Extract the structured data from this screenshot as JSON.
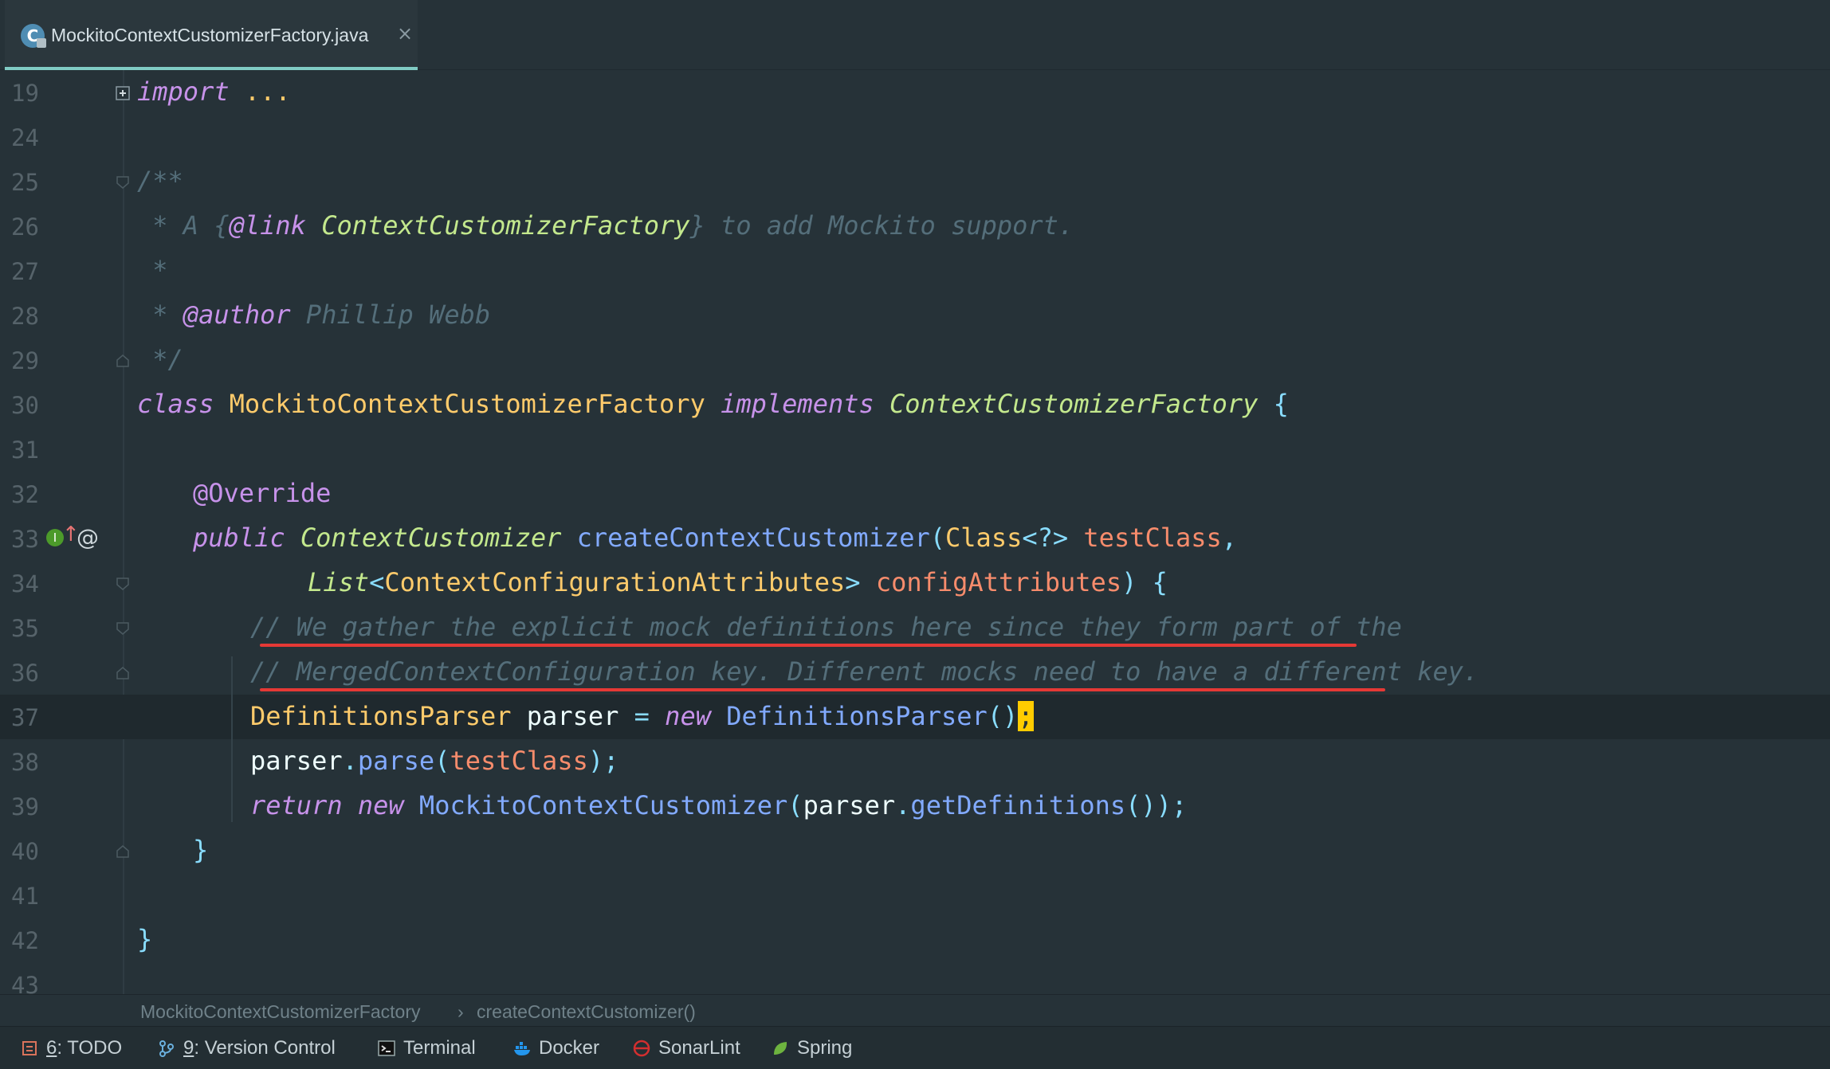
{
  "tab": {
    "label": "MockitoContextCustomizerFactory.java",
    "icon": "java-class-icon",
    "close": "×"
  },
  "lines": [
    {
      "n": "19",
      "tokens": [
        [
          "kw",
          "import"
        ],
        [
          "plain",
          " "
        ],
        [
          "cls",
          "..."
        ]
      ]
    },
    {
      "n": "24",
      "tokens": []
    },
    {
      "n": "25",
      "tokens": [
        [
          "cm",
          "/**"
        ]
      ]
    },
    {
      "n": "26",
      "tokens": [
        [
          "cm",
          " * A {"
        ],
        [
          "doctag",
          "@link"
        ],
        [
          "cm",
          " "
        ],
        [
          "docref",
          "ContextCustomizerFactory"
        ],
        [
          "cm",
          "} to add Mockito support."
        ]
      ]
    },
    {
      "n": "27",
      "tokens": [
        [
          "cm",
          " *"
        ]
      ]
    },
    {
      "n": "28",
      "tokens": [
        [
          "cm",
          " * "
        ],
        [
          "doctag",
          "@author"
        ],
        [
          "cm",
          " Phillip Webb"
        ]
      ]
    },
    {
      "n": "29",
      "tokens": [
        [
          "cm",
          " */"
        ]
      ]
    },
    {
      "n": "30",
      "tokens": [
        [
          "kw",
          "class"
        ],
        [
          "plain",
          " "
        ],
        [
          "cls",
          "MockitoContextCustomizerFactory"
        ],
        [
          "plain",
          " "
        ],
        [
          "kw",
          "implements"
        ],
        [
          "plain",
          " "
        ],
        [
          "iface",
          "ContextCustomizerFactory"
        ],
        [
          "plain",
          " "
        ],
        [
          "punc",
          "{"
        ]
      ]
    },
    {
      "n": "31",
      "tokens": []
    },
    {
      "n": "32",
      "tokens": [
        [
          "ann",
          "@Override"
        ]
      ]
    },
    {
      "n": "33",
      "tokens": [
        [
          "kw",
          "public"
        ],
        [
          "plain",
          " "
        ],
        [
          "iface",
          "ContextCustomizer"
        ],
        [
          "plain",
          " "
        ],
        [
          "fn",
          "createContextCustomizer"
        ],
        [
          "punc",
          "("
        ],
        [
          "cls",
          "Class"
        ],
        [
          "punc",
          "<?>"
        ],
        [
          "plain",
          " "
        ],
        [
          "param",
          "testClass"
        ],
        [
          "punc",
          ","
        ]
      ]
    },
    {
      "n": "34",
      "tokens": [
        [
          "iface",
          "List"
        ],
        [
          "punc",
          "<"
        ],
        [
          "cls",
          "ContextConfigurationAttributes"
        ],
        [
          "punc",
          ">"
        ],
        [
          "plain",
          " "
        ],
        [
          "param",
          "configAttributes"
        ],
        [
          "punc",
          ")"
        ],
        [
          "plain",
          " "
        ],
        [
          "punc",
          "{"
        ]
      ]
    },
    {
      "n": "35",
      "tokens": [
        [
          "cm",
          "// We gather the explicit mock definitions here since they form part of the"
        ]
      ]
    },
    {
      "n": "36",
      "tokens": [
        [
          "cm",
          "// MergedContextConfiguration key. Different mocks need to have a different key."
        ]
      ]
    },
    {
      "n": "37",
      "tokens": [
        [
          "cls",
          "DefinitionsParser"
        ],
        [
          "plain",
          " parser "
        ],
        [
          "punc",
          "="
        ],
        [
          "plain",
          " "
        ],
        [
          "kw",
          "new"
        ],
        [
          "plain",
          " "
        ],
        [
          "fn",
          "DefinitionsParser"
        ],
        [
          "punc",
          "()"
        ],
        [
          "caret",
          ";"
        ]
      ]
    },
    {
      "n": "38",
      "tokens": [
        [
          "plain",
          "parser"
        ],
        [
          "punc",
          "."
        ],
        [
          "fn",
          "parse"
        ],
        [
          "punc",
          "("
        ],
        [
          "param",
          "testClass"
        ],
        [
          "punc",
          ");"
        ]
      ]
    },
    {
      "n": "39",
      "tokens": [
        [
          "kw",
          "return"
        ],
        [
          "plain",
          " "
        ],
        [
          "kw",
          "new"
        ],
        [
          "plain",
          " "
        ],
        [
          "fn",
          "MockitoContextCustomizer"
        ],
        [
          "punc",
          "("
        ],
        [
          "plain",
          "parser"
        ],
        [
          "punc",
          "."
        ],
        [
          "fn",
          "getDefinitions"
        ],
        [
          "punc",
          "());"
        ]
      ]
    },
    {
      "n": "40",
      "tokens": [
        [
          "punc",
          "}"
        ]
      ]
    },
    {
      "n": "41",
      "tokens": []
    },
    {
      "n": "42",
      "tokens": [
        [
          "punc",
          "}"
        ]
      ]
    },
    {
      "n": "43",
      "tokens": []
    }
  ],
  "breadcrumb": {
    "class_name": "MockitoContextCustomizerFactory",
    "separator": "›",
    "method_name": "createContextCustomizer()"
  },
  "tool_windows": [
    {
      "key": "6",
      "label": ": TODO",
      "icon": "todo-icon"
    },
    {
      "key": "9",
      "label": ": Version Control",
      "icon": "branch-icon"
    },
    {
      "key": "",
      "label": "Terminal",
      "icon": "terminal-icon"
    },
    {
      "key": "",
      "label": "Docker",
      "icon": "docker-icon"
    },
    {
      "key": "",
      "label": "SonarLint",
      "icon": "sonarlint-icon"
    },
    {
      "key": "",
      "label": "Spring",
      "icon": "spring-leaf-icon"
    }
  ],
  "colors": {
    "background": "#263238",
    "accent": "#80cbc4",
    "error_underline": "#e53935",
    "caret": "#ffcc00"
  }
}
